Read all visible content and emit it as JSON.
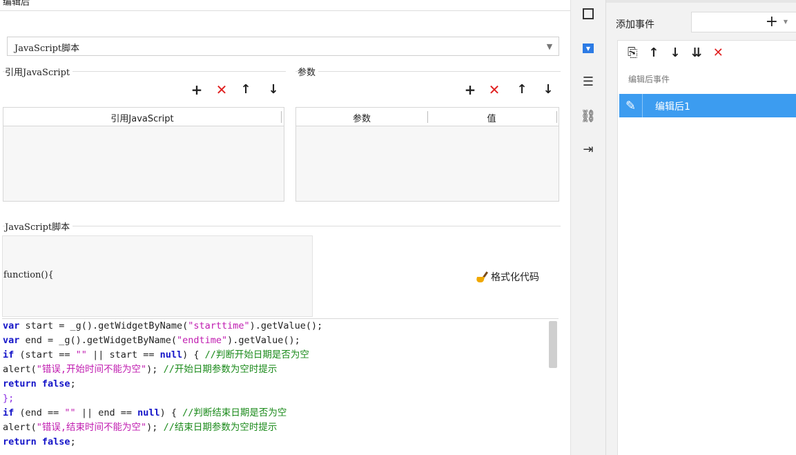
{
  "main": {
    "title": "编辑后",
    "type_select": "JavaScript脚本",
    "ref_section_label": "引用JavaScript",
    "param_section_label": "参数",
    "ref_table_header": "引用JavaScript",
    "param_table_headers": [
      "参数",
      "值"
    ],
    "script_section_label": "JavaScript脚本",
    "function_signature": "function(){",
    "format_button": "格式化代码",
    "code_lines": [
      [
        {
          "t": "var",
          "c": "kw"
        },
        {
          "t": " start = _g().getWidgetByName(",
          "c": "pl"
        },
        {
          "t": "\"starttime\"",
          "c": "str"
        },
        {
          "t": ").getValue();",
          "c": "pl"
        }
      ],
      [
        {
          "t": "var",
          "c": "kw"
        },
        {
          "t": " end = _g().getWidgetByName(",
          "c": "pl"
        },
        {
          "t": "\"endtime\"",
          "c": "str"
        },
        {
          "t": ").getValue();",
          "c": "pl"
        }
      ],
      [
        {
          "t": "if",
          "c": "kw"
        },
        {
          "t": " (start == ",
          "c": "pl"
        },
        {
          "t": "\"\"",
          "c": "str"
        },
        {
          "t": " || start == ",
          "c": "pl"
        },
        {
          "t": "null",
          "c": "kw"
        },
        {
          "t": ") { ",
          "c": "pl"
        },
        {
          "t": "//判断开始日期是否为空",
          "c": "cm"
        }
      ],
      [
        {
          "t": "alert(",
          "c": "pl"
        },
        {
          "t": "\"错误,开始时间不能为空\"",
          "c": "str"
        },
        {
          "t": "); ",
          "c": "pl"
        },
        {
          "t": "//开始日期参数为空时提示",
          "c": "cm"
        }
      ],
      [
        {
          "t": "return",
          "c": "kw"
        },
        {
          "t": " ",
          "c": "pl"
        },
        {
          "t": "false",
          "c": "kw"
        },
        {
          "t": ";",
          "c": "pl"
        }
      ],
      [
        {
          "t": "};",
          "c": "pu"
        }
      ],
      [
        {
          "t": "if",
          "c": "kw"
        },
        {
          "t": " (end == ",
          "c": "pl"
        },
        {
          "t": "\"\"",
          "c": "str"
        },
        {
          "t": " || end == ",
          "c": "pl"
        },
        {
          "t": "null",
          "c": "kw"
        },
        {
          "t": ") { ",
          "c": "pl"
        },
        {
          "t": "//判断结束日期是否为空",
          "c": "cm"
        }
      ],
      [
        {
          "t": "alert(",
          "c": "pl"
        },
        {
          "t": "\"错误,结束时间不能为空\"",
          "c": "str"
        },
        {
          "t": "); ",
          "c": "pl"
        },
        {
          "t": "//结束日期参数为空时提示",
          "c": "cm"
        }
      ],
      [
        {
          "t": "return",
          "c": "kw"
        },
        {
          "t": " ",
          "c": "pl"
        },
        {
          "t": "false",
          "c": "kw"
        },
        {
          "t": ";",
          "c": "pl"
        }
      ]
    ]
  },
  "toolbar_icons": [
    "plus-icon",
    "delete-icon",
    "arrow-up-icon",
    "arrow-down-icon"
  ],
  "strip": {
    "icons": [
      "square-icon",
      "dropdown-icon",
      "list-icon",
      "link-icon",
      "import-icon"
    ]
  },
  "events": {
    "add_event_label": "添加事件",
    "group_label": "编辑后事件",
    "items": [
      {
        "label": "编辑后1"
      }
    ],
    "toolbar_icons": [
      "copy-icon",
      "arrow-up-icon",
      "arrow-down-icon",
      "move-bottom-icon",
      "delete-icon"
    ]
  },
  "colors": {
    "selected": "#3c9cf0",
    "delete": "#e02020",
    "keyword": "#1414c8",
    "string": "#c01cb0",
    "comment": "#1a8a1a"
  }
}
